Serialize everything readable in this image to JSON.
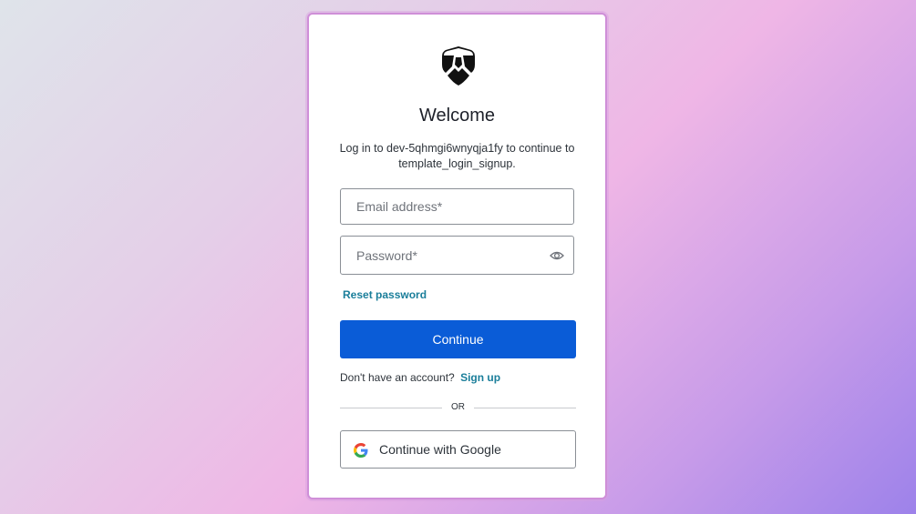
{
  "login": {
    "title": "Welcome",
    "subtitle": "Log in to dev-5qhmgi6wnyqja1fy to continue to template_login_signup.",
    "email_placeholder": "Email address*",
    "email_value": "",
    "password_placeholder": "Password*",
    "password_value": "",
    "reset_password_label": "Reset password",
    "continue_label": "Continue",
    "signup_prompt": "Don't have an account?",
    "signup_link": "Sign up",
    "divider_text": "OR",
    "google_label": "Continue with Google"
  },
  "icons": {
    "logo": "shield-logo-icon",
    "password_toggle": "eye-icon",
    "google": "google-g-icon"
  },
  "colors": {
    "primary_button": "#0a5cd7",
    "link": "#1a7e9a",
    "card_border": "#cf8fd8"
  }
}
